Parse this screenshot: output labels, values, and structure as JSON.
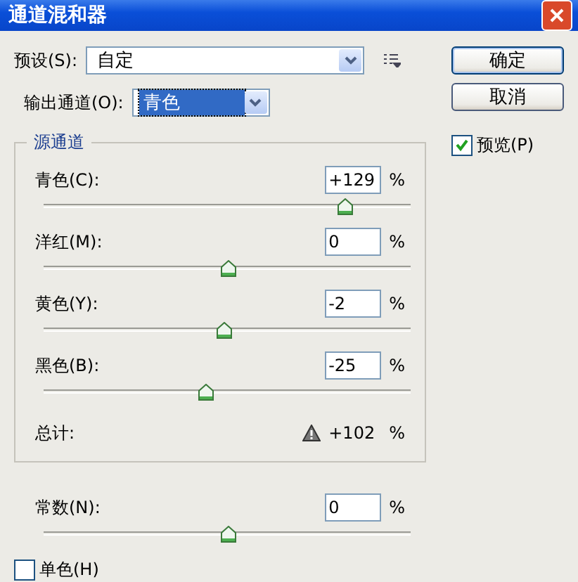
{
  "window": {
    "title": "通道混和器"
  },
  "preset": {
    "label": "预设(S):",
    "value": "自定"
  },
  "output_channel": {
    "label": "输出通道(O):",
    "value": "青色"
  },
  "source_channels": {
    "title": "源通道",
    "sliders": [
      {
        "label": "青色(C):",
        "value": "+129",
        "unit": "%",
        "level": 0.82
      },
      {
        "label": "洋红(M):",
        "value": "0",
        "unit": "%",
        "level": 0.5
      },
      {
        "label": "黄色(Y):",
        "value": "-2",
        "unit": "%",
        "level": 0.49
      },
      {
        "label": "黑色(B):",
        "value": "-25",
        "unit": "%",
        "level": 0.44
      }
    ],
    "total": {
      "label": "总计:",
      "value": "+102",
      "unit": "%",
      "warning": true
    }
  },
  "constant": {
    "label": "常数(N):",
    "value": "0",
    "unit": "%",
    "level": 0.5
  },
  "monochrome": {
    "label": "单色(H)",
    "checked": false
  },
  "buttons": [
    {
      "label": "确定",
      "default": true
    },
    {
      "label": "取消",
      "default": false
    }
  ],
  "preview": {
    "label": "预览(P)",
    "checked": true
  }
}
